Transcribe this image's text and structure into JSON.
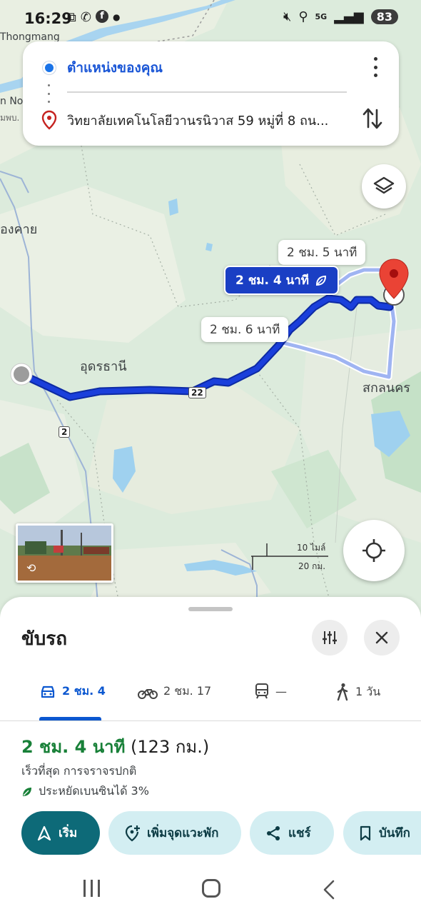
{
  "status_bar": {
    "time": "16:29",
    "battery": "83",
    "network": "5G"
  },
  "search": {
    "origin": "ตำแหน่งของคุณ",
    "destination": "วิทยาลัยเทคโนโลยีวานรนิวาส 59 หมู่ที่ 8 ถน..."
  },
  "map": {
    "route_labels": {
      "main": "2 ชม. 4 นาที",
      "alt_1": "2 ชม. 5 นาที",
      "alt_2": "2 ชม. 6 นาที"
    },
    "place_labels": {
      "thongmang": "Thongmang",
      "n_no": "n No",
      "n_label": "มพบ.",
      "nongkhai": "องคาย",
      "udon": "อุดรธานี",
      "sakon": "สกลนคร"
    },
    "road_shields": {
      "r22": "22",
      "r2": "2"
    },
    "scale": {
      "miles": "10 ไมล์",
      "km": "20 กม."
    }
  },
  "sheet": {
    "title": "ขับรถ",
    "modes": [
      {
        "label": "2 ชม. 4",
        "icon": "car-icon"
      },
      {
        "label": "2 ชม. 17",
        "icon": "motorcycle-icon"
      },
      {
        "label": "—",
        "icon": "transit-icon"
      },
      {
        "label": "1 วัน",
        "icon": "walk-icon"
      }
    ],
    "route": {
      "time": "2 ชม. 4 นาที",
      "distance": "(123 กม.)",
      "description": "เร็วที่สุด การจราจรปกติ",
      "eco": "ประหยัดเบนซินได้ 3%"
    },
    "actions": {
      "start": "เริ่ม",
      "add_stop": "เพิ่มจุดแวะพัก",
      "share": "แชร์",
      "save": "บันทึก"
    }
  },
  "colors": {
    "route_main": "#1a3fc4",
    "route_alt": "#9fb4f2",
    "start_button": "#0d6a78",
    "time_green": "#188038"
  }
}
